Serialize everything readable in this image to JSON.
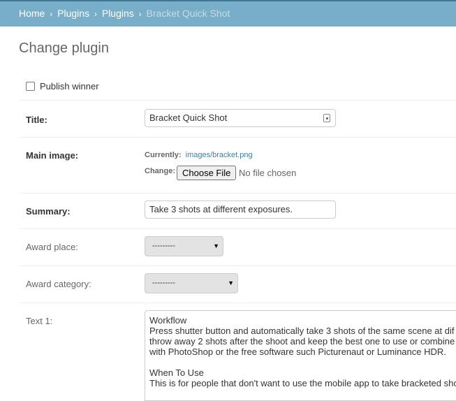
{
  "breadcrumbs": {
    "home": "Home",
    "plugins_app": "Plugins",
    "plugins_model": "Plugins",
    "current": "Bracket Quick Shot",
    "separator": "›"
  },
  "page": {
    "title": "Change plugin"
  },
  "form": {
    "publish_winner": {
      "label": "Publish winner",
      "checked": false
    },
    "title": {
      "label": "Title:",
      "value": "Bracket Quick Shot"
    },
    "main_image": {
      "label": "Main image:",
      "currently_label": "Currently:",
      "currently_value": "images/bracket.png",
      "change_label": "Change:",
      "button": "Choose File",
      "status": "No file chosen"
    },
    "summary": {
      "label": "Summary:",
      "value": "Take 3 shots at different exposures."
    },
    "award_place": {
      "label": "Award place:",
      "value": "---------"
    },
    "award_category": {
      "label": "Award category:",
      "value": "---------"
    },
    "text1": {
      "label": "Text 1:",
      "value": "Workflow\nPress shutter button and automatically take 3 shots of the same scene at dif\nthrow away 2 shots after the shoot and keep the best one to use or combine\nwith PhotoShop or the free software such Picturenaut or Luminance HDR.\n\nWhen To Use\nThis is for people that don't want to use the mobile app to take bracketed sho"
    }
  },
  "icons": {
    "select_arrow": "▼"
  },
  "colors": {
    "breadcrumb_bg": "#79aec8",
    "breadcrumb_current": "#c4dce8",
    "link": "#447e9b",
    "select_bg": "#e3e3e3"
  }
}
